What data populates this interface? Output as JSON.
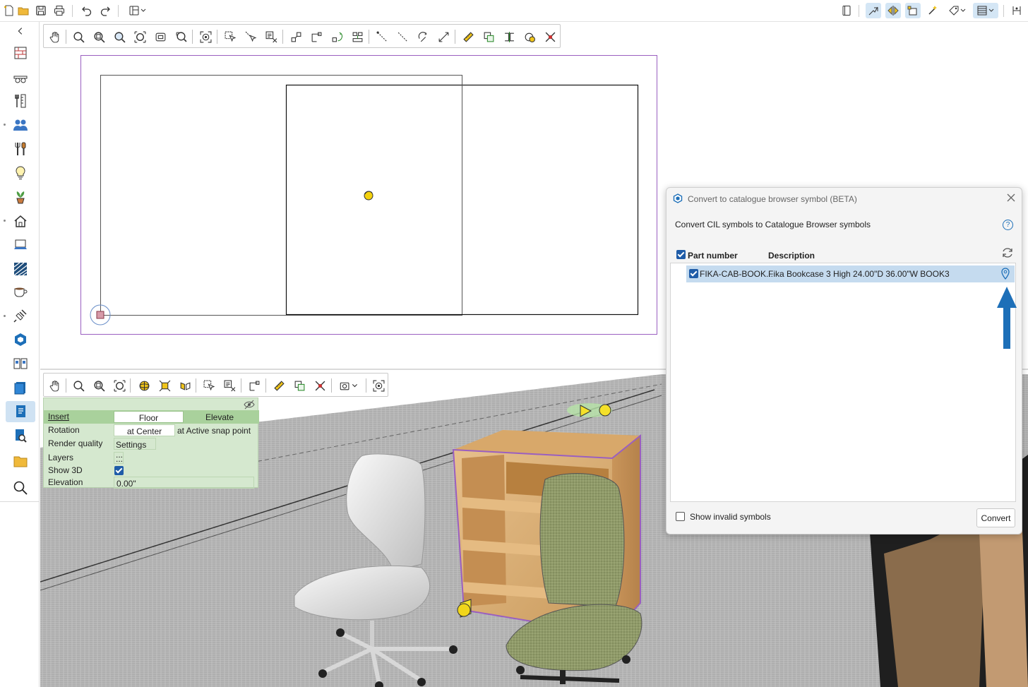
{
  "toolbar_right_active": [
    "snap-mode-1",
    "snap-mode-2",
    "snap-mode-3",
    "layout-view"
  ],
  "properties": {
    "rows": [
      {
        "label": "Insert",
        "col1": "Floor",
        "col2": "Elevate"
      },
      {
        "label": "Rotation",
        "col1": "at Center",
        "col2": "at Active snap point"
      },
      {
        "label": "Render quality",
        "col1": "Settings ...",
        "col2": ""
      },
      {
        "label": "Layers",
        "col1": "...",
        "col2": ""
      },
      {
        "label": "Show 3D",
        "col1": "",
        "col2": ""
      },
      {
        "label": "Elevation",
        "col1": "0.00\"",
        "col2": ""
      }
    ],
    "show3d_checked": true
  },
  "dialog": {
    "title": "Convert to catalogue browser symbol (BETA)",
    "subtitle": "Convert CIL symbols to Catalogue Browser symbols",
    "help": "?",
    "col_part": "Part number",
    "col_desc": "Description",
    "items": [
      {
        "part": "FIKA-CAB-BOOK...",
        "desc": "Fika Bookcase 3 High 24.00\"D 36.00\"W BOOK3",
        "checked": true
      }
    ],
    "show_invalid_label": "Show invalid symbols",
    "show_invalid_checked": false,
    "convert_label": "Convert",
    "accent": "#1d6fb8"
  },
  "colors": {
    "selection_outline": "#9a5fc0",
    "panel_green": "#d5e8cf",
    "accent_blue": "#1d6fb8"
  }
}
